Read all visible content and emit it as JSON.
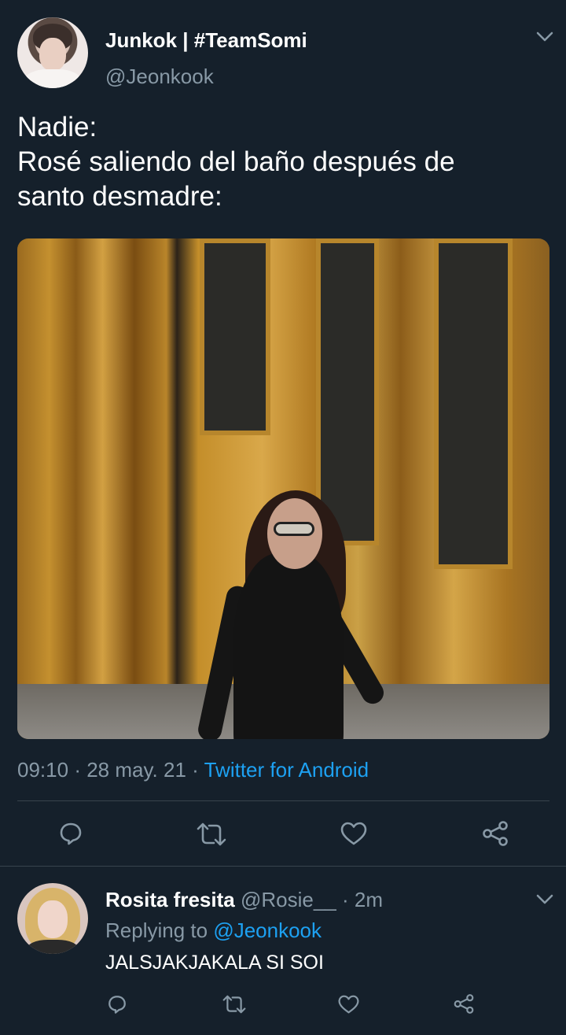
{
  "tweet": {
    "author": {
      "display_name": "Junkok | #TeamSomi",
      "handle": "@Jeonkook",
      "avatar": "user-avatar"
    },
    "text": "Nadie:\nRosé saliendo del baño después de\nsanto desmadre:",
    "photo": "woman in black dress walking out of golden revolving door",
    "time": "09:10",
    "date": "28 may. 21",
    "separator": "·",
    "source": "Twitter for Android",
    "actions": [
      "reply-icon",
      "retweet-icon",
      "like-icon",
      "share-icon"
    ]
  },
  "reply": {
    "author": {
      "display_name": "Rosita fresita",
      "handle": "@Rosie__",
      "time": "· 2m",
      "avatar": "user-avatar"
    },
    "replying_prefix": "Replying to",
    "replying_handle": "@Jeonkook",
    "text": "JALSJAKJAKALA SI SOI",
    "actions": [
      "reply-icon",
      "retweet-icon",
      "like-icon",
      "share-icon"
    ]
  },
  "colors": {
    "background": "#15202b",
    "secondary_text": "#8899a6",
    "link": "#1da1f2",
    "divider": "#38444d"
  }
}
